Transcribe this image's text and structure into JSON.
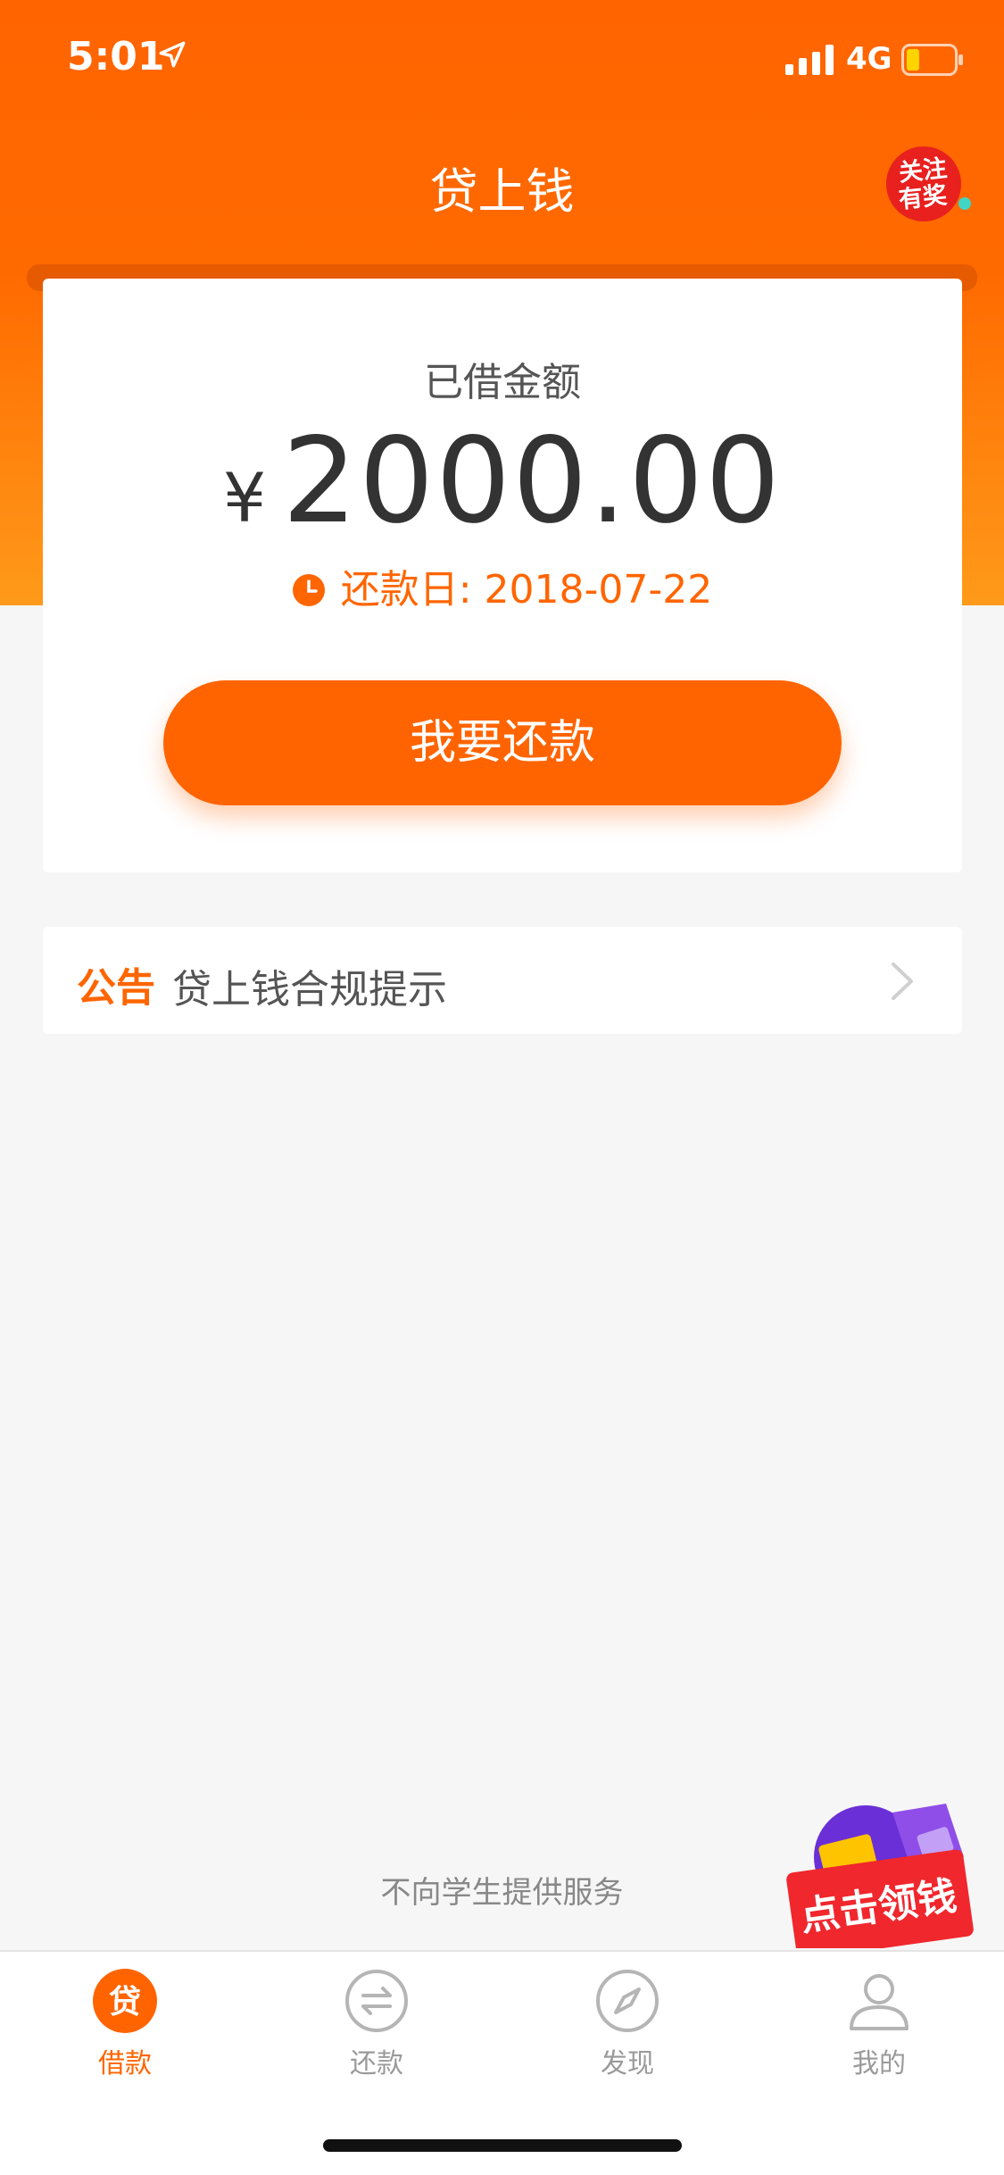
{
  "status": {
    "time": "5:01",
    "network": "4G"
  },
  "nav": {
    "title": "贷上钱",
    "promo_badge": "关注有奖"
  },
  "loan": {
    "label": "已借金额",
    "currency": "¥",
    "amount": "2000.00",
    "due_label": "还款日: 2018-07-22",
    "repay_button": "我要还款"
  },
  "notice": {
    "tag": "公告",
    "text": "贷上钱合规提示"
  },
  "footer_note": "不向学生提供服务",
  "floating_promo": "点击领钱",
  "tabs": [
    {
      "label": "借款",
      "icon": "loan-icon",
      "active": true
    },
    {
      "label": "还款",
      "icon": "repay-icon",
      "active": false
    },
    {
      "label": "发现",
      "icon": "compass-icon",
      "active": false
    },
    {
      "label": "我的",
      "icon": "profile-icon",
      "active": false
    }
  ],
  "colors": {
    "brand": "#ff6400",
    "accent_text": "#ff6500",
    "inactive": "#9a9a9a",
    "background": "#f6f6f6"
  }
}
